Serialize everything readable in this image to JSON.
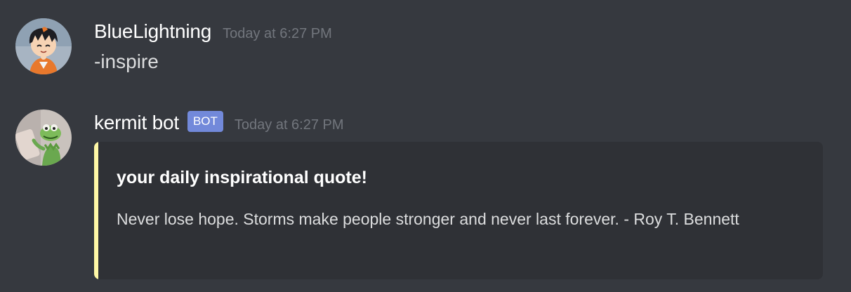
{
  "messages": [
    {
      "username": "BlueLightning",
      "timestamp": "Today at 6:27 PM",
      "text": "-inspire",
      "avatar_icon": "anime-figure-avatar-icon"
    },
    {
      "username": "kermit bot",
      "bot_tag": "BOT",
      "timestamp": "Today at 6:27 PM",
      "avatar_icon": "kermit-frog-avatar-icon",
      "embed": {
        "accent_color": "#fff8a6",
        "title": "your daily inspirational quote!",
        "description": "Never lose hope. Storms make people stronger and never last forever. - Roy T. Bennett"
      }
    }
  ],
  "colors": {
    "background": "#36393f",
    "embed_background": "#2f3136",
    "bot_tag": "#7289da",
    "timestamp": "#72767d"
  }
}
